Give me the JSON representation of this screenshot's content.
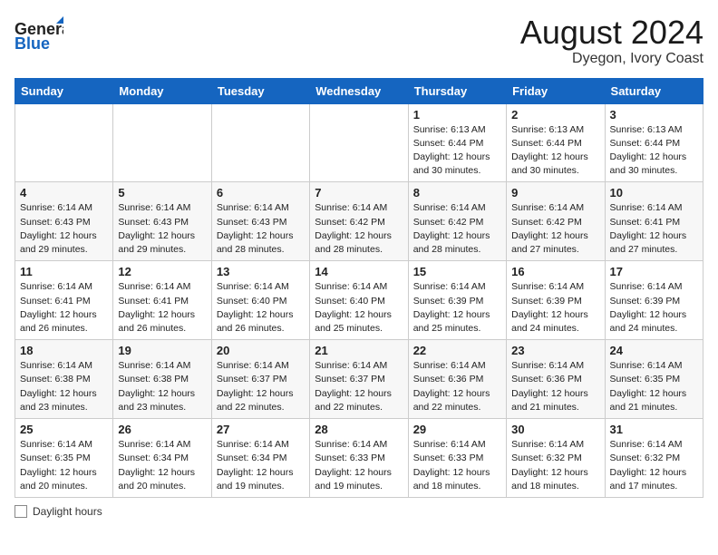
{
  "header": {
    "logo_general": "General",
    "logo_blue": "Blue",
    "month": "August 2024",
    "location": "Dyegon, Ivory Coast"
  },
  "weekdays": [
    "Sunday",
    "Monday",
    "Tuesday",
    "Wednesday",
    "Thursday",
    "Friday",
    "Saturday"
  ],
  "weeks": [
    [
      {
        "day": "",
        "info": ""
      },
      {
        "day": "",
        "info": ""
      },
      {
        "day": "",
        "info": ""
      },
      {
        "day": "",
        "info": ""
      },
      {
        "day": "1",
        "info": "Sunrise: 6:13 AM\nSunset: 6:44 PM\nDaylight: 12 hours\nand 30 minutes."
      },
      {
        "day": "2",
        "info": "Sunrise: 6:13 AM\nSunset: 6:44 PM\nDaylight: 12 hours\nand 30 minutes."
      },
      {
        "day": "3",
        "info": "Sunrise: 6:13 AM\nSunset: 6:44 PM\nDaylight: 12 hours\nand 30 minutes."
      }
    ],
    [
      {
        "day": "4",
        "info": "Sunrise: 6:14 AM\nSunset: 6:43 PM\nDaylight: 12 hours\nand 29 minutes."
      },
      {
        "day": "5",
        "info": "Sunrise: 6:14 AM\nSunset: 6:43 PM\nDaylight: 12 hours\nand 29 minutes."
      },
      {
        "day": "6",
        "info": "Sunrise: 6:14 AM\nSunset: 6:43 PM\nDaylight: 12 hours\nand 28 minutes."
      },
      {
        "day": "7",
        "info": "Sunrise: 6:14 AM\nSunset: 6:42 PM\nDaylight: 12 hours\nand 28 minutes."
      },
      {
        "day": "8",
        "info": "Sunrise: 6:14 AM\nSunset: 6:42 PM\nDaylight: 12 hours\nand 28 minutes."
      },
      {
        "day": "9",
        "info": "Sunrise: 6:14 AM\nSunset: 6:42 PM\nDaylight: 12 hours\nand 27 minutes."
      },
      {
        "day": "10",
        "info": "Sunrise: 6:14 AM\nSunset: 6:41 PM\nDaylight: 12 hours\nand 27 minutes."
      }
    ],
    [
      {
        "day": "11",
        "info": "Sunrise: 6:14 AM\nSunset: 6:41 PM\nDaylight: 12 hours\nand 26 minutes."
      },
      {
        "day": "12",
        "info": "Sunrise: 6:14 AM\nSunset: 6:41 PM\nDaylight: 12 hours\nand 26 minutes."
      },
      {
        "day": "13",
        "info": "Sunrise: 6:14 AM\nSunset: 6:40 PM\nDaylight: 12 hours\nand 26 minutes."
      },
      {
        "day": "14",
        "info": "Sunrise: 6:14 AM\nSunset: 6:40 PM\nDaylight: 12 hours\nand 25 minutes."
      },
      {
        "day": "15",
        "info": "Sunrise: 6:14 AM\nSunset: 6:39 PM\nDaylight: 12 hours\nand 25 minutes."
      },
      {
        "day": "16",
        "info": "Sunrise: 6:14 AM\nSunset: 6:39 PM\nDaylight: 12 hours\nand 24 minutes."
      },
      {
        "day": "17",
        "info": "Sunrise: 6:14 AM\nSunset: 6:39 PM\nDaylight: 12 hours\nand 24 minutes."
      }
    ],
    [
      {
        "day": "18",
        "info": "Sunrise: 6:14 AM\nSunset: 6:38 PM\nDaylight: 12 hours\nand 23 minutes."
      },
      {
        "day": "19",
        "info": "Sunrise: 6:14 AM\nSunset: 6:38 PM\nDaylight: 12 hours\nand 23 minutes."
      },
      {
        "day": "20",
        "info": "Sunrise: 6:14 AM\nSunset: 6:37 PM\nDaylight: 12 hours\nand 22 minutes."
      },
      {
        "day": "21",
        "info": "Sunrise: 6:14 AM\nSunset: 6:37 PM\nDaylight: 12 hours\nand 22 minutes."
      },
      {
        "day": "22",
        "info": "Sunrise: 6:14 AM\nSunset: 6:36 PM\nDaylight: 12 hours\nand 22 minutes."
      },
      {
        "day": "23",
        "info": "Sunrise: 6:14 AM\nSunset: 6:36 PM\nDaylight: 12 hours\nand 21 minutes."
      },
      {
        "day": "24",
        "info": "Sunrise: 6:14 AM\nSunset: 6:35 PM\nDaylight: 12 hours\nand 21 minutes."
      }
    ],
    [
      {
        "day": "25",
        "info": "Sunrise: 6:14 AM\nSunset: 6:35 PM\nDaylight: 12 hours\nand 20 minutes."
      },
      {
        "day": "26",
        "info": "Sunrise: 6:14 AM\nSunset: 6:34 PM\nDaylight: 12 hours\nand 20 minutes."
      },
      {
        "day": "27",
        "info": "Sunrise: 6:14 AM\nSunset: 6:34 PM\nDaylight: 12 hours\nand 19 minutes."
      },
      {
        "day": "28",
        "info": "Sunrise: 6:14 AM\nSunset: 6:33 PM\nDaylight: 12 hours\nand 19 minutes."
      },
      {
        "day": "29",
        "info": "Sunrise: 6:14 AM\nSunset: 6:33 PM\nDaylight: 12 hours\nand 18 minutes."
      },
      {
        "day": "30",
        "info": "Sunrise: 6:14 AM\nSunset: 6:32 PM\nDaylight: 12 hours\nand 18 minutes."
      },
      {
        "day": "31",
        "info": "Sunrise: 6:14 AM\nSunset: 6:32 PM\nDaylight: 12 hours\nand 17 minutes."
      }
    ]
  ],
  "footer": {
    "label": "Daylight hours"
  }
}
